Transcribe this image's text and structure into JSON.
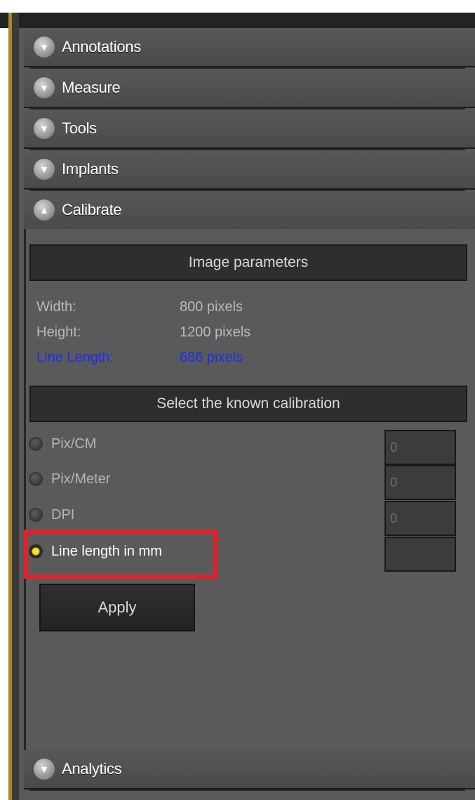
{
  "accordion": {
    "annotations": "Annotations",
    "measure": "Measure",
    "tools": "Tools",
    "implants": "Implants",
    "calibrate": "Calibrate",
    "analytics": "Analytics"
  },
  "calibrate": {
    "image_parameters_title": "Image parameters",
    "width_label": "Width:",
    "width_value": "800 pixels",
    "height_label": "Height:",
    "height_value": "1200 pixels",
    "line_length_label": "Line Length:",
    "line_length_value": "686 pixels",
    "known_calibration_title": "Select the known calibration",
    "options": [
      {
        "label": "Pix/CM",
        "value": "0",
        "selected": false
      },
      {
        "label": "Pix/Meter",
        "value": "0",
        "selected": false
      },
      {
        "label": "DPI",
        "value": "0",
        "selected": false
      },
      {
        "label": "Line length in mm",
        "value": "",
        "selected": true
      }
    ],
    "apply_label": "Apply"
  },
  "colors": {
    "highlight": "#e4202a",
    "accent": "#1d2df0",
    "panel": "#595959"
  },
  "icons": {
    "collapsed": "chevron-down-icon",
    "expanded": "chevron-up-icon",
    "radio_selected": "radio-selected-icon",
    "radio_unselected": "radio-unselected-icon"
  }
}
